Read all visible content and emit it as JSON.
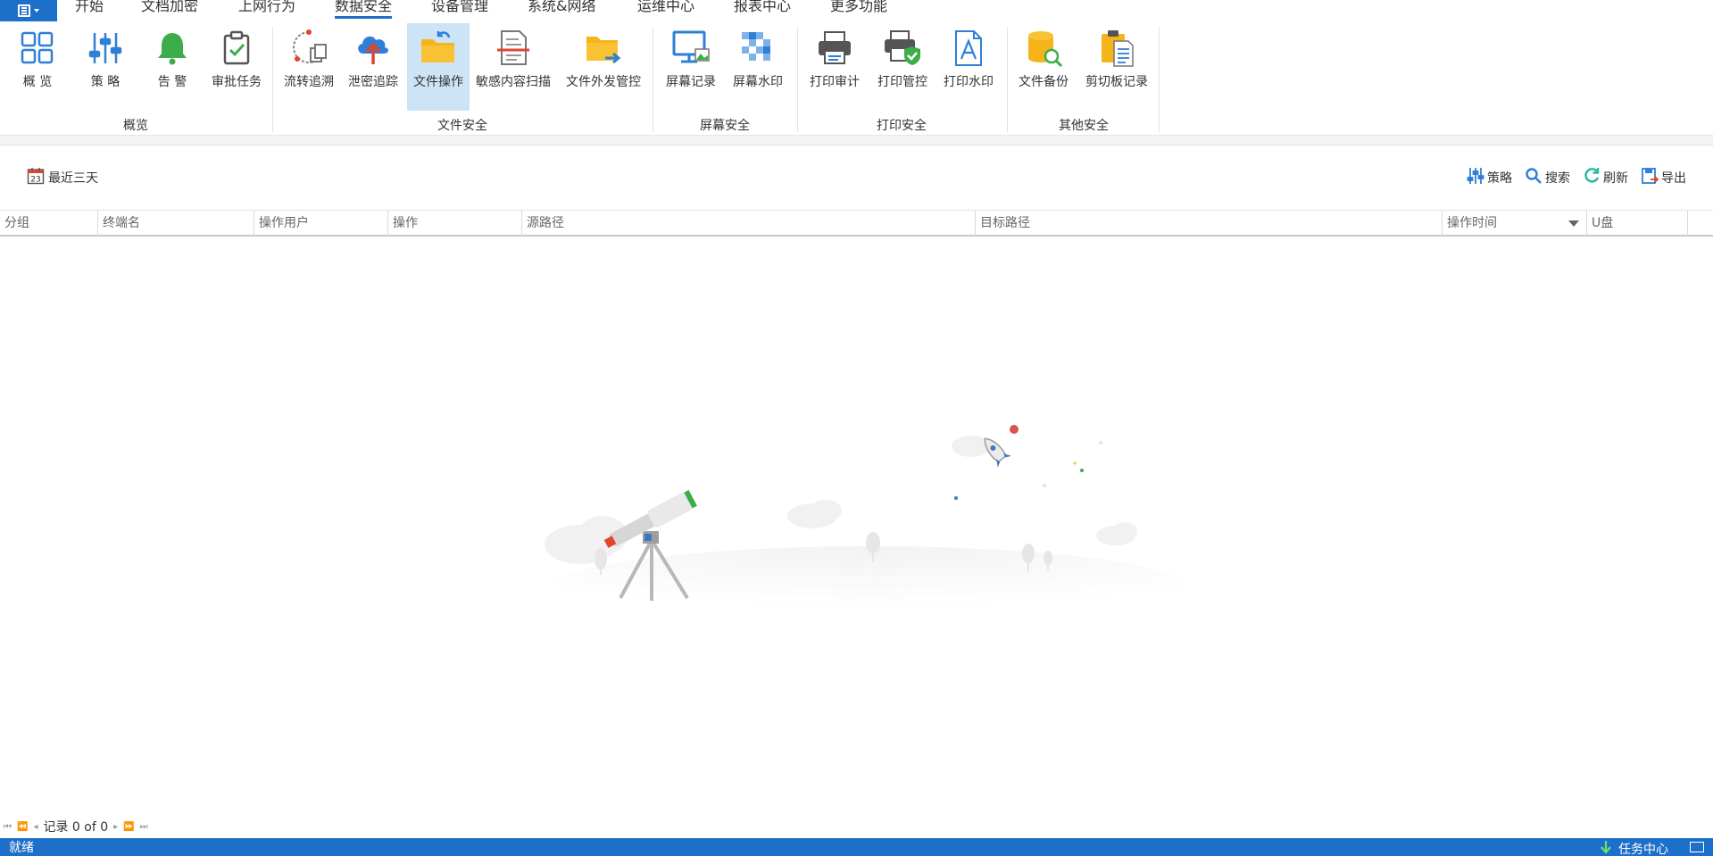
{
  "menu": {
    "tabs": [
      {
        "label": "开始"
      },
      {
        "label": "文档加密"
      },
      {
        "label": "上网行为"
      },
      {
        "label": "数据安全"
      },
      {
        "label": "设备管理"
      },
      {
        "label": "系统&网络"
      },
      {
        "label": "运维中心"
      },
      {
        "label": "报表中心"
      },
      {
        "label": "更多功能"
      }
    ],
    "active_tab": "数据安全"
  },
  "ribbon": {
    "buttons": [
      {
        "label": "概  览"
      },
      {
        "label": "策  略"
      },
      {
        "label": "告  警"
      },
      {
        "label": "审批任务"
      },
      {
        "label": "流转追溯"
      },
      {
        "label": "泄密追踪"
      },
      {
        "label": "文件操作"
      },
      {
        "label": "敏感内容扫描"
      },
      {
        "label": "文件外发管控"
      },
      {
        "label": "屏幕记录"
      },
      {
        "label": "屏幕水印"
      },
      {
        "label": "打印审计"
      },
      {
        "label": "打印管控"
      },
      {
        "label": "打印水印"
      },
      {
        "label": "文件备份"
      },
      {
        "label": "剪切板记录"
      }
    ],
    "groups": [
      {
        "label": "概览"
      },
      {
        "label": "文件安全"
      },
      {
        "label": "屏幕安全"
      },
      {
        "label": "打印安全"
      },
      {
        "label": "其他安全"
      }
    ],
    "selected_button": "文件操作"
  },
  "toolbar": {
    "date_filter": "最近三天",
    "calendar_day": "23",
    "actions": [
      {
        "label": "策略"
      },
      {
        "label": "搜索"
      },
      {
        "label": "刷新"
      },
      {
        "label": "导出"
      }
    ]
  },
  "grid": {
    "columns": [
      {
        "label": "分组"
      },
      {
        "label": "终端名"
      },
      {
        "label": "操作用户"
      },
      {
        "label": "操作"
      },
      {
        "label": "源路径"
      },
      {
        "label": "目标路径"
      },
      {
        "label": "操作时间"
      },
      {
        "label": "U盘"
      }
    ],
    "rows": []
  },
  "pager": {
    "text": "记录 0 of 0"
  },
  "statusbar": {
    "status": "就绪",
    "task_center": "任务中心"
  },
  "colors": {
    "accent": "#1e6fc9",
    "selected_bg": "#cde4f7"
  }
}
